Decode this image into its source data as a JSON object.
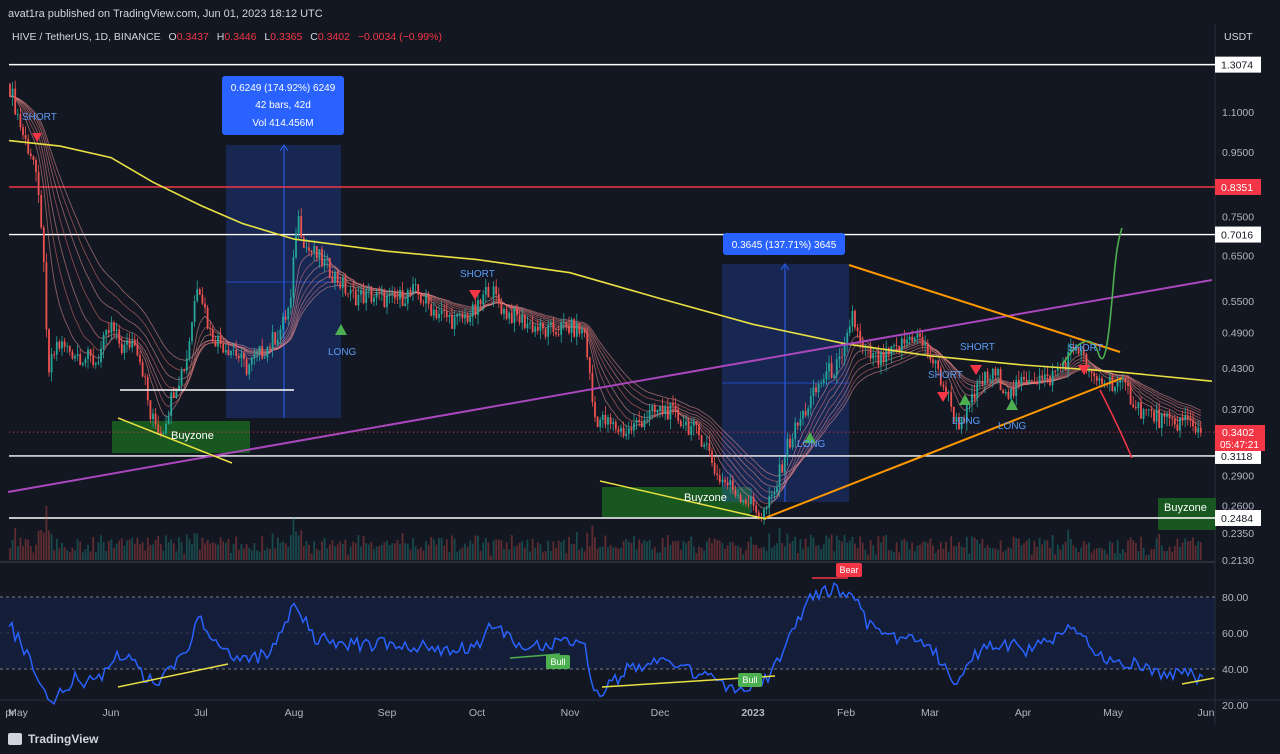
{
  "header": {
    "published": "avat1ra published on TradingView.com, Jun 01, 2023 18:12 UTC",
    "symbol": "HIVE / TetherUS, 1D, BINANCE",
    "o_label": "O",
    "o_value": "0.3437",
    "h_label": "H",
    "h_value": "0.3446",
    "l_label": "L",
    "l_value": "0.3365",
    "c_label": "C",
    "c_value": "0.3402",
    "change": "−0.0034 (−0.99%)",
    "currency": "USDT"
  },
  "footer": {
    "brand": "TradingView"
  },
  "colors": {
    "background": "#131722",
    "up": "#26a69a",
    "down": "#ef5350",
    "ema200": "#e9e043",
    "trendline": "#ab47bc",
    "triangle": "#ff9800",
    "rsi": "#2962ff"
  },
  "chart_data": {
    "type": "candlestick",
    "price_axis": {
      "scale": "log",
      "ticks": [
        "1.1000",
        "0.9500",
        "0.7500",
        "0.6500",
        "0.5500",
        "0.4900",
        "0.4300",
        "0.3700",
        "0.2900",
        "0.2600",
        "0.2350",
        "0.2130"
      ],
      "tick_values": [
        1.1,
        0.95,
        0.75,
        0.65,
        0.55,
        0.49,
        0.43,
        0.37,
        0.29,
        0.26,
        0.235,
        0.213
      ]
    },
    "time_axis": [
      "pr",
      "May",
      "Jun",
      "Jul",
      "Aug",
      "Sep",
      "Oct",
      "Nov",
      "Dec",
      "2023",
      "Feb",
      "Mar",
      "Apr",
      "May",
      "Jun"
    ],
    "horizontal_levels": [
      {
        "value": 1.3074,
        "label": "1.3074",
        "color": "#ffffff"
      },
      {
        "value": 0.8351,
        "label": "0.8351",
        "color": "#f23645"
      },
      {
        "value": 0.7016,
        "label": "0.7016",
        "color": "#ffffff"
      },
      {
        "value": 0.3118,
        "label": "0.3118",
        "color": "#ffffff"
      },
      {
        "value": 0.2484,
        "label": "0.2484",
        "color": "#ffffff"
      }
    ],
    "current_price": {
      "value": 0.3402,
      "label": "0.3402",
      "countdown": "05:47:21"
    },
    "measure_boxes": [
      {
        "lines": [
          "0.6249 (174.92%) 6249",
          "42 bars, 42d",
          "Vol 414.456M"
        ]
      },
      {
        "lines": [
          "0.3645 (137.71%) 3645"
        ]
      }
    ],
    "annotations": {
      "short": "SHORT",
      "long": "LONG",
      "buyzone": "Buyzone",
      "bull": "Bull",
      "bear": "Bear"
    },
    "price_path": [
      [
        "2022-04-28",
        1.22
      ],
      [
        "2022-05-03",
        1.0
      ],
      [
        "2022-05-06",
        0.93
      ],
      [
        "2022-05-09",
        0.72
      ],
      [
        "2022-05-11",
        0.42
      ],
      [
        "2022-05-14",
        0.47
      ],
      [
        "2022-05-18",
        0.46
      ],
      [
        "2022-05-22",
        0.45
      ],
      [
        "2022-05-27",
        0.44
      ],
      [
        "2022-06-01",
        0.5
      ],
      [
        "2022-06-05",
        0.46
      ],
      [
        "2022-06-09",
        0.48
      ],
      [
        "2022-06-12",
        0.42
      ],
      [
        "2022-06-14",
        0.36
      ],
      [
        "2022-06-18",
        0.34
      ],
      [
        "2022-06-22",
        0.4
      ],
      [
        "2022-06-26",
        0.44
      ],
      [
        "2022-06-30",
        0.6
      ],
      [
        "2022-07-04",
        0.49
      ],
      [
        "2022-07-08",
        0.47
      ],
      [
        "2022-07-12",
        0.46
      ],
      [
        "2022-07-16",
        0.43
      ],
      [
        "2022-07-20",
        0.45
      ],
      [
        "2022-07-24",
        0.47
      ],
      [
        "2022-07-28",
        0.5
      ],
      [
        "2022-07-31",
        0.55
      ],
      [
        "2022-08-02",
        0.76
      ],
      [
        "2022-08-05",
        0.67
      ],
      [
        "2022-08-10",
        0.64
      ],
      [
        "2022-08-15",
        0.6
      ],
      [
        "2022-08-20",
        0.56
      ],
      [
        "2022-08-27",
        0.56
      ],
      [
        "2022-09-03",
        0.55
      ],
      [
        "2022-09-10",
        0.57
      ],
      [
        "2022-09-17",
        0.53
      ],
      [
        "2022-09-24",
        0.51
      ],
      [
        "2022-10-01",
        0.53
      ],
      [
        "2022-10-05",
        0.58
      ],
      [
        "2022-10-10",
        0.53
      ],
      [
        "2022-10-17",
        0.51
      ],
      [
        "2022-10-24",
        0.49
      ],
      [
        "2022-10-31",
        0.5
      ],
      [
        "2022-11-06",
        0.49
      ],
      [
        "2022-11-09",
        0.36
      ],
      [
        "2022-11-14",
        0.35
      ],
      [
        "2022-11-20",
        0.34
      ],
      [
        "2022-11-26",
        0.36
      ],
      [
        "2022-12-03",
        0.37
      ],
      [
        "2022-12-10",
        0.35
      ],
      [
        "2022-12-16",
        0.33
      ],
      [
        "2022-12-20",
        0.29
      ],
      [
        "2022-12-24",
        0.28
      ],
      [
        "2022-12-28",
        0.27
      ],
      [
        "2023-01-01",
        0.26
      ],
      [
        "2023-01-04",
        0.25
      ],
      [
        "2023-01-08",
        0.27
      ],
      [
        "2023-01-12",
        0.32
      ],
      [
        "2023-01-16",
        0.35
      ],
      [
        "2023-01-20",
        0.38
      ],
      [
        "2023-01-25",
        0.42
      ],
      [
        "2023-01-31",
        0.44
      ],
      [
        "2023-02-03",
        0.53
      ],
      [
        "2023-02-06",
        0.46
      ],
      [
        "2023-02-12",
        0.44
      ],
      [
        "2023-02-18",
        0.46
      ],
      [
        "2023-02-24",
        0.49
      ],
      [
        "2023-03-01",
        0.45
      ],
      [
        "2023-03-06",
        0.4
      ],
      [
        "2023-03-10",
        0.35
      ],
      [
        "2023-03-14",
        0.37
      ],
      [
        "2023-03-18",
        0.41
      ],
      [
        "2023-03-23",
        0.42
      ],
      [
        "2023-03-28",
        0.39
      ],
      [
        "2023-04-03",
        0.42
      ],
      [
        "2023-04-09",
        0.41
      ],
      [
        "2023-04-15",
        0.44
      ],
      [
        "2023-04-19",
        0.47
      ],
      [
        "2023-04-24",
        0.41
      ],
      [
        "2023-04-30",
        0.41
      ],
      [
        "2023-05-05",
        0.4
      ],
      [
        "2023-05-10",
        0.37
      ],
      [
        "2023-05-15",
        0.36
      ],
      [
        "2023-05-20",
        0.35
      ],
      [
        "2023-05-25",
        0.355
      ],
      [
        "2023-05-31",
        0.34
      ]
    ],
    "ema200": [
      [
        "2022-04-28",
        0.99
      ],
      [
        "2022-05-15",
        0.97
      ],
      [
        "2022-06-01",
        0.93
      ],
      [
        "2022-06-15",
        0.85
      ],
      [
        "2022-07-01",
        0.78
      ],
      [
        "2022-07-15",
        0.73
      ],
      [
        "2022-08-01",
        0.69
      ],
      [
        "2022-09-01",
        0.66
      ],
      [
        "2022-10-01",
        0.64
      ],
      [
        "2022-11-01",
        0.61
      ],
      [
        "2022-12-01",
        0.555
      ],
      [
        "2023-01-01",
        0.505
      ],
      [
        "2023-02-01",
        0.47
      ],
      [
        "2023-03-01",
        0.45
      ],
      [
        "2023-04-01",
        0.435
      ],
      [
        "2023-05-01",
        0.425
      ],
      [
        "2023-06-03",
        0.41
      ]
    ],
    "rsi": {
      "ticks": [
        80,
        60,
        40,
        20
      ],
      "path": [
        [
          "2022-04-28",
          65
        ],
        [
          "2022-05-05",
          45
        ],
        [
          "2022-05-10",
          28
        ],
        [
          "2022-05-13",
          22
        ],
        [
          "2022-05-20",
          35
        ],
        [
          "2022-05-27",
          32
        ],
        [
          "2022-06-03",
          50
        ],
        [
          "2022-06-10",
          40
        ],
        [
          "2022-06-16",
          30
        ],
        [
          "2022-06-24",
          45
        ],
        [
          "2022-07-01",
          68
        ],
        [
          "2022-07-08",
          52
        ],
        [
          "2022-07-16",
          44
        ],
        [
          "2022-07-24",
          50
        ],
        [
          "2022-08-01",
          75
        ],
        [
          "2022-08-08",
          58
        ],
        [
          "2022-08-20",
          53
        ],
        [
          "2022-09-05",
          55
        ],
        [
          "2022-09-20",
          50
        ],
        [
          "2022-10-01",
          52
        ],
        [
          "2022-10-06",
          65
        ],
        [
          "2022-10-15",
          52
        ],
        [
          "2022-10-31",
          56
        ],
        [
          "2022-11-06",
          55
        ],
        [
          "2022-11-09",
          24
        ],
        [
          "2022-11-20",
          40
        ],
        [
          "2022-12-01",
          44
        ],
        [
          "2022-12-10",
          40
        ],
        [
          "2022-12-20",
          33
        ],
        [
          "2022-12-27",
          30
        ],
        [
          "2023-01-05",
          33
        ],
        [
          "2023-01-14",
          60
        ],
        [
          "2023-01-20",
          78
        ],
        [
          "2023-01-27",
          84
        ],
        [
          "2023-02-03",
          82
        ],
        [
          "2023-02-08",
          65
        ],
        [
          "2023-02-18",
          58
        ],
        [
          "2023-02-28",
          55
        ],
        [
          "2023-03-10",
          32
        ],
        [
          "2023-03-18",
          52
        ],
        [
          "2023-03-25",
          55
        ],
        [
          "2023-04-03",
          50
        ],
        [
          "2023-04-12",
          58
        ],
        [
          "2023-04-19",
          63
        ],
        [
          "2023-04-26",
          48
        ],
        [
          "2023-05-05",
          44
        ],
        [
          "2023-05-15",
          38
        ],
        [
          "2023-05-25",
          38
        ],
        [
          "2023-05-31",
          33
        ]
      ]
    }
  }
}
